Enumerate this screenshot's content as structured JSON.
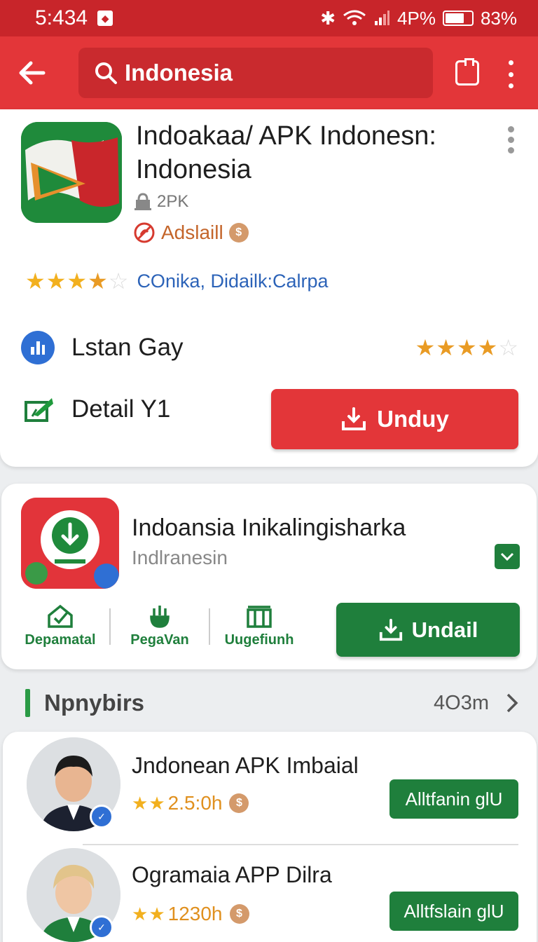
{
  "status_bar": {
    "time": "5:434",
    "signal_text": "4P%",
    "battery": "83%"
  },
  "topbar": {
    "search_text": "Indonesia"
  },
  "featured_app": {
    "title": "Indoakaa/  APK Indonesn: Indonesia",
    "size": "2PK",
    "ads_label": "Adslaill",
    "coin_glyph": "$",
    "rating_label": "COnika, Didailk:Calrpa",
    "rating_stars": 3.5,
    "info_row_label": "Lstan Gay",
    "info_row_stars": 3.5,
    "detail_label": "Detail Y1",
    "download_button": "Unduy"
  },
  "second_app": {
    "title": "Indoansia Inikalingisharka",
    "subtitle": "Indlranesin",
    "actions": [
      {
        "label": "Depamatal",
        "icon": "shield-check-icon"
      },
      {
        "label": "PegaVan",
        "icon": "hand-icon"
      },
      {
        "label": "Uugefiunh",
        "icon": "grid-icon"
      }
    ],
    "download_button": "Undail"
  },
  "section": {
    "title": "Npnybirs",
    "meta": "4O3m"
  },
  "list": [
    {
      "title": "Jndonean APK Imbaial",
      "rating_text": "2.5:0h",
      "stars": 2,
      "button": "Alltfanin glU"
    },
    {
      "title": "Ogramaia APP Dilra",
      "rating_text": "1230h",
      "stars": 2,
      "button": "Alltfslain glU"
    }
  ],
  "colors": {
    "brand_red": "#e33639",
    "status_red": "#c8252a",
    "green": "#1f7f3c",
    "star": "#f2b01e",
    "link_blue": "#2c63b8"
  }
}
